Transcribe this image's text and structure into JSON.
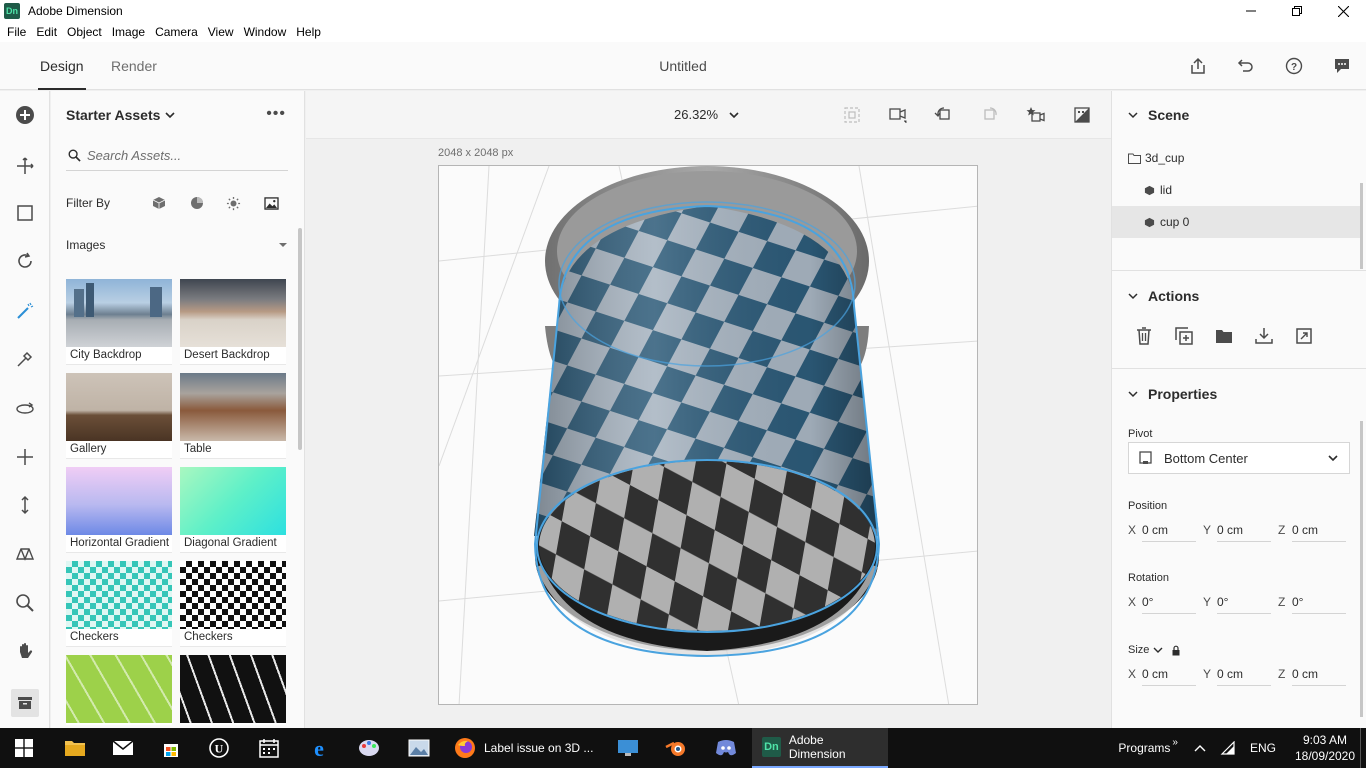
{
  "window": {
    "title": "Adobe Dimension",
    "logo": "Dn"
  },
  "menu": [
    "File",
    "Edit",
    "Object",
    "Image",
    "Camera",
    "View",
    "Window",
    "Help"
  ],
  "header": {
    "tabs": [
      {
        "label": "Design",
        "active": true
      },
      {
        "label": "Render",
        "active": false
      }
    ],
    "document_title": "Untitled",
    "icons": [
      "share-icon",
      "undo-icon",
      "help-icon",
      "feedback-icon"
    ]
  },
  "tools": [
    "add-icon",
    "select-icon",
    "marquee-icon",
    "orbit-icon",
    "magic-wand-icon",
    "sample-icon",
    "rotate-icon",
    "move-icon",
    "scale-icon",
    "camera-icon",
    "zoom-icon",
    "pan-icon",
    "archive-icon"
  ],
  "assets": {
    "title": "Starter Assets",
    "search_placeholder": "Search Assets...",
    "filter_label": "Filter By",
    "section": "Images",
    "items": [
      {
        "label": "City Backdrop"
      },
      {
        "label": "Desert Backdrop"
      },
      {
        "label": "Gallery"
      },
      {
        "label": "Table"
      },
      {
        "label": "Horizontal Gradient"
      },
      {
        "label": "Diagonal Gradient"
      },
      {
        "label": "Checkers"
      },
      {
        "label": "Checkers"
      }
    ]
  },
  "canvas": {
    "zoom": "26.32%",
    "dimensions": "2048 x 2048 px"
  },
  "scene": {
    "title": "Scene",
    "items": [
      {
        "label": "3d_cup",
        "type": "folder"
      },
      {
        "label": "lid",
        "type": "model"
      },
      {
        "label": "cup 0",
        "type": "model",
        "selected": true
      }
    ]
  },
  "actions": {
    "title": "Actions"
  },
  "properties": {
    "title": "Properties",
    "pivot_label": "Pivot",
    "pivot_value": "Bottom Center",
    "position": {
      "label": "Position",
      "x": "0 cm",
      "y": "0 cm",
      "z": "0 cm"
    },
    "rotation": {
      "label": "Rotation",
      "x": "0°",
      "y": "0°",
      "z": "0°"
    },
    "size": {
      "label": "Size",
      "x": "0 cm",
      "y": "0 cm",
      "z": "0 cm"
    },
    "axes": [
      "X",
      "Y",
      "Z"
    ]
  },
  "taskbar": {
    "apps": [
      {
        "label": "Label issue on 3D ..."
      },
      {
        "label": "Adobe Dimension"
      }
    ],
    "programs": "Programs",
    "language": "ENG",
    "time": "9:03 AM",
    "date": "18/09/2020"
  },
  "colors": {
    "accent": "#1f5b48",
    "selection": "#4aa3df",
    "checker_blue": "#2c5a78"
  }
}
